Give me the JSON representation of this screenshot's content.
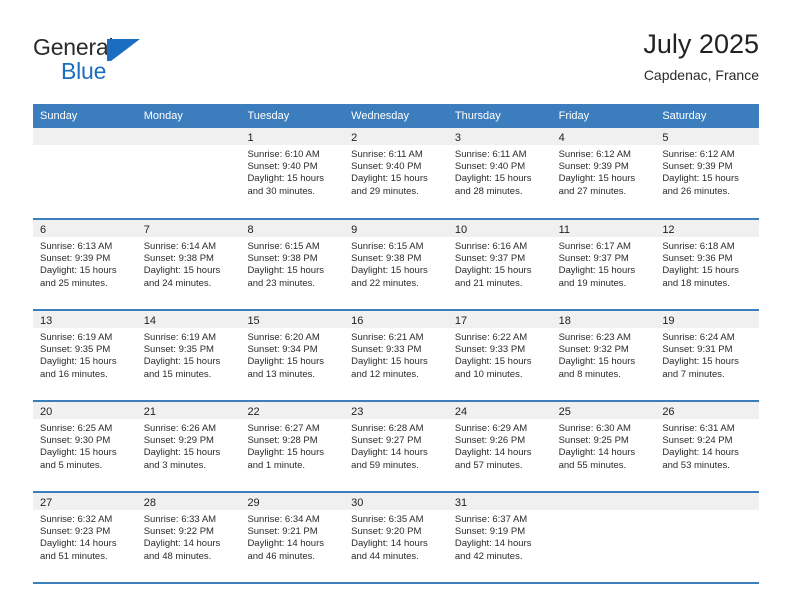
{
  "brand": {
    "name_top": "General",
    "name_bottom": "Blue",
    "mark": "blue-triangle-flag"
  },
  "header": {
    "title": "July 2025",
    "location": "Capdenac, France"
  },
  "colors": {
    "header_blue": "#3b7dbd",
    "brand_blue": "#1b6dc1",
    "band_gray": "#f0f0f0",
    "text": "#2b2b2b"
  },
  "weekdays": [
    "Sunday",
    "Monday",
    "Tuesday",
    "Wednesday",
    "Thursday",
    "Friday",
    "Saturday"
  ],
  "weeks": [
    [
      {
        "day": "",
        "empty": true
      },
      {
        "day": "",
        "empty": true
      },
      {
        "day": "1",
        "sunrise": "Sunrise: 6:10 AM",
        "sunset": "Sunset: 9:40 PM",
        "daylight": "Daylight: 15 hours and 30 minutes."
      },
      {
        "day": "2",
        "sunrise": "Sunrise: 6:11 AM",
        "sunset": "Sunset: 9:40 PM",
        "daylight": "Daylight: 15 hours and 29 minutes."
      },
      {
        "day": "3",
        "sunrise": "Sunrise: 6:11 AM",
        "sunset": "Sunset: 9:40 PM",
        "daylight": "Daylight: 15 hours and 28 minutes."
      },
      {
        "day": "4",
        "sunrise": "Sunrise: 6:12 AM",
        "sunset": "Sunset: 9:39 PM",
        "daylight": "Daylight: 15 hours and 27 minutes."
      },
      {
        "day": "5",
        "sunrise": "Sunrise: 6:12 AM",
        "sunset": "Sunset: 9:39 PM",
        "daylight": "Daylight: 15 hours and 26 minutes."
      }
    ],
    [
      {
        "day": "6",
        "sunrise": "Sunrise: 6:13 AM",
        "sunset": "Sunset: 9:39 PM",
        "daylight": "Daylight: 15 hours and 25 minutes."
      },
      {
        "day": "7",
        "sunrise": "Sunrise: 6:14 AM",
        "sunset": "Sunset: 9:38 PM",
        "daylight": "Daylight: 15 hours and 24 minutes."
      },
      {
        "day": "8",
        "sunrise": "Sunrise: 6:15 AM",
        "sunset": "Sunset: 9:38 PM",
        "daylight": "Daylight: 15 hours and 23 minutes."
      },
      {
        "day": "9",
        "sunrise": "Sunrise: 6:15 AM",
        "sunset": "Sunset: 9:38 PM",
        "daylight": "Daylight: 15 hours and 22 minutes."
      },
      {
        "day": "10",
        "sunrise": "Sunrise: 6:16 AM",
        "sunset": "Sunset: 9:37 PM",
        "daylight": "Daylight: 15 hours and 21 minutes."
      },
      {
        "day": "11",
        "sunrise": "Sunrise: 6:17 AM",
        "sunset": "Sunset: 9:37 PM",
        "daylight": "Daylight: 15 hours and 19 minutes."
      },
      {
        "day": "12",
        "sunrise": "Sunrise: 6:18 AM",
        "sunset": "Sunset: 9:36 PM",
        "daylight": "Daylight: 15 hours and 18 minutes."
      }
    ],
    [
      {
        "day": "13",
        "sunrise": "Sunrise: 6:19 AM",
        "sunset": "Sunset: 9:35 PM",
        "daylight": "Daylight: 15 hours and 16 minutes."
      },
      {
        "day": "14",
        "sunrise": "Sunrise: 6:19 AM",
        "sunset": "Sunset: 9:35 PM",
        "daylight": "Daylight: 15 hours and 15 minutes."
      },
      {
        "day": "15",
        "sunrise": "Sunrise: 6:20 AM",
        "sunset": "Sunset: 9:34 PM",
        "daylight": "Daylight: 15 hours and 13 minutes."
      },
      {
        "day": "16",
        "sunrise": "Sunrise: 6:21 AM",
        "sunset": "Sunset: 9:33 PM",
        "daylight": "Daylight: 15 hours and 12 minutes."
      },
      {
        "day": "17",
        "sunrise": "Sunrise: 6:22 AM",
        "sunset": "Sunset: 9:33 PM",
        "daylight": "Daylight: 15 hours and 10 minutes."
      },
      {
        "day": "18",
        "sunrise": "Sunrise: 6:23 AM",
        "sunset": "Sunset: 9:32 PM",
        "daylight": "Daylight: 15 hours and 8 minutes."
      },
      {
        "day": "19",
        "sunrise": "Sunrise: 6:24 AM",
        "sunset": "Sunset: 9:31 PM",
        "daylight": "Daylight: 15 hours and 7 minutes."
      }
    ],
    [
      {
        "day": "20",
        "sunrise": "Sunrise: 6:25 AM",
        "sunset": "Sunset: 9:30 PM",
        "daylight": "Daylight: 15 hours and 5 minutes."
      },
      {
        "day": "21",
        "sunrise": "Sunrise: 6:26 AM",
        "sunset": "Sunset: 9:29 PM",
        "daylight": "Daylight: 15 hours and 3 minutes."
      },
      {
        "day": "22",
        "sunrise": "Sunrise: 6:27 AM",
        "sunset": "Sunset: 9:28 PM",
        "daylight": "Daylight: 15 hours and 1 minute."
      },
      {
        "day": "23",
        "sunrise": "Sunrise: 6:28 AM",
        "sunset": "Sunset: 9:27 PM",
        "daylight": "Daylight: 14 hours and 59 minutes."
      },
      {
        "day": "24",
        "sunrise": "Sunrise: 6:29 AM",
        "sunset": "Sunset: 9:26 PM",
        "daylight": "Daylight: 14 hours and 57 minutes."
      },
      {
        "day": "25",
        "sunrise": "Sunrise: 6:30 AM",
        "sunset": "Sunset: 9:25 PM",
        "daylight": "Daylight: 14 hours and 55 minutes."
      },
      {
        "day": "26",
        "sunrise": "Sunrise: 6:31 AM",
        "sunset": "Sunset: 9:24 PM",
        "daylight": "Daylight: 14 hours and 53 minutes."
      }
    ],
    [
      {
        "day": "27",
        "sunrise": "Sunrise: 6:32 AM",
        "sunset": "Sunset: 9:23 PM",
        "daylight": "Daylight: 14 hours and 51 minutes."
      },
      {
        "day": "28",
        "sunrise": "Sunrise: 6:33 AM",
        "sunset": "Sunset: 9:22 PM",
        "daylight": "Daylight: 14 hours and 48 minutes."
      },
      {
        "day": "29",
        "sunrise": "Sunrise: 6:34 AM",
        "sunset": "Sunset: 9:21 PM",
        "daylight": "Daylight: 14 hours and 46 minutes."
      },
      {
        "day": "30",
        "sunrise": "Sunrise: 6:35 AM",
        "sunset": "Sunset: 9:20 PM",
        "daylight": "Daylight: 14 hours and 44 minutes."
      },
      {
        "day": "31",
        "sunrise": "Sunrise: 6:37 AM",
        "sunset": "Sunset: 9:19 PM",
        "daylight": "Daylight: 14 hours and 42 minutes."
      },
      {
        "day": "",
        "empty": true
      },
      {
        "day": "",
        "empty": true
      }
    ]
  ]
}
